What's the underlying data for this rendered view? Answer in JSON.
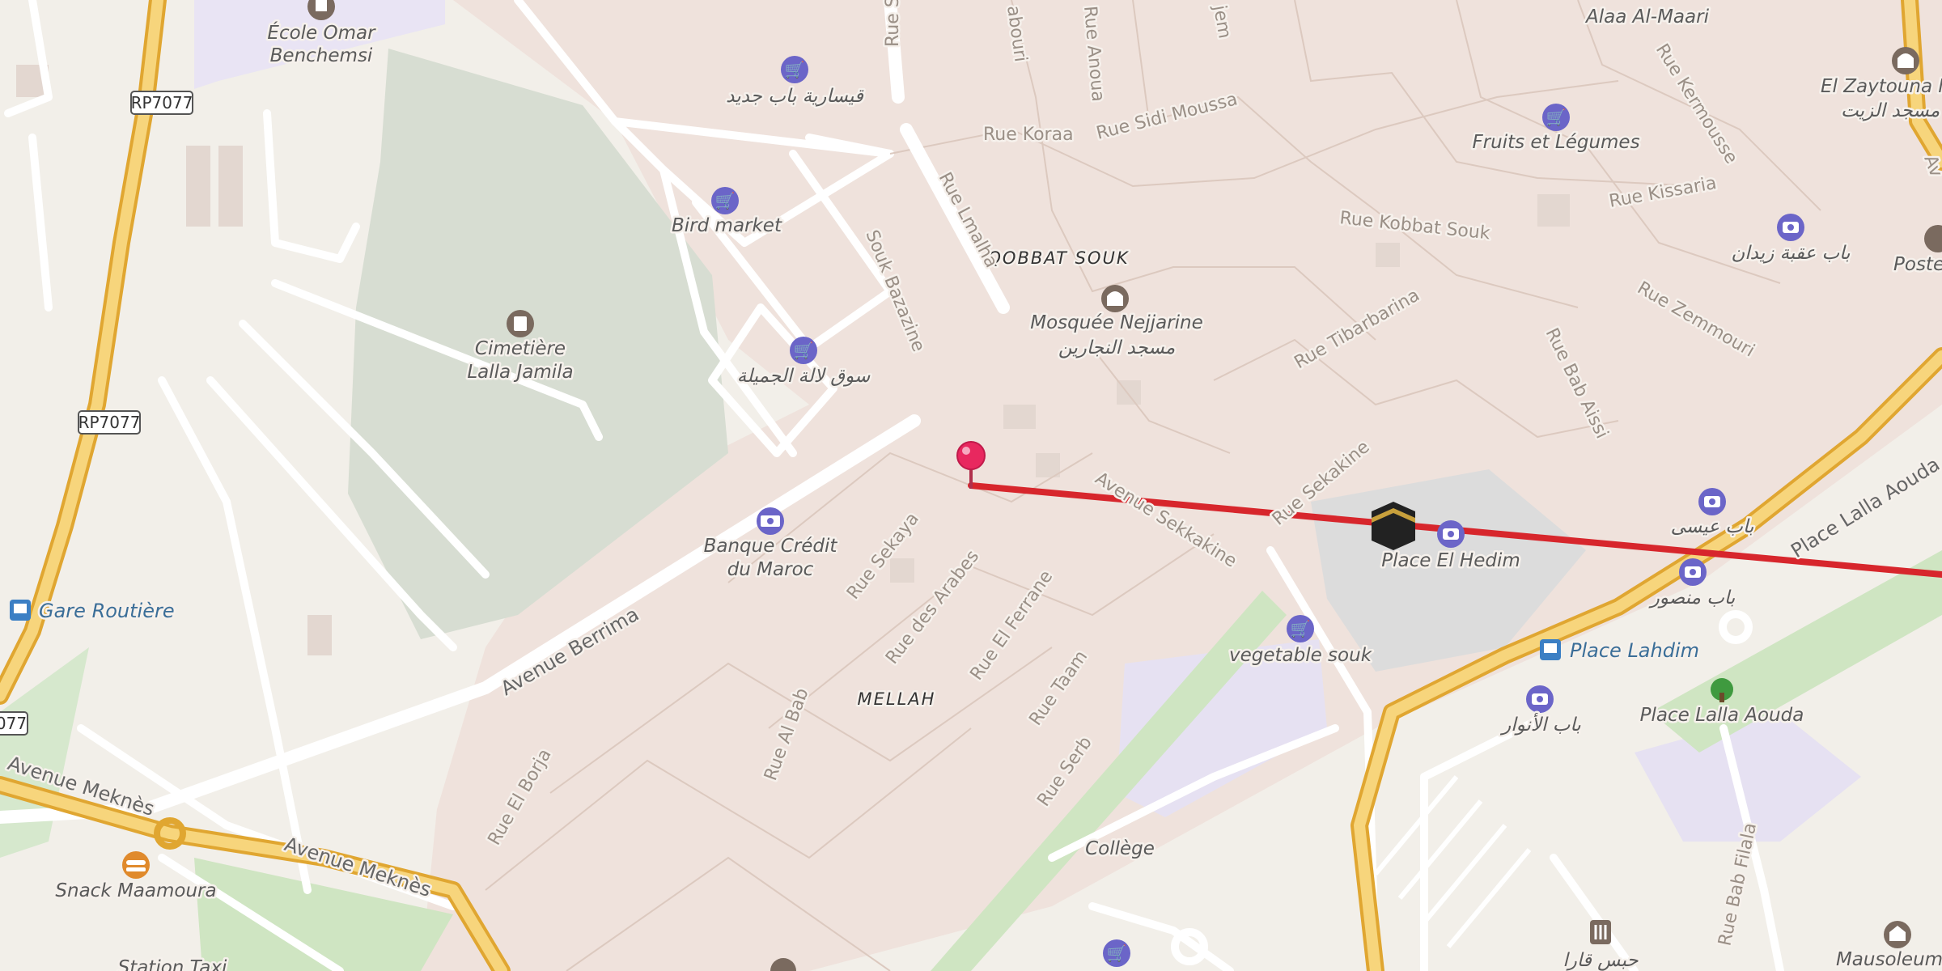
{
  "map": {
    "route_color": "#d7262c",
    "pin_color": "#e8285f",
    "labels": {
      "ecole": "École Omar",
      "ecole2": "Benchemsi",
      "qissaria": "قيسارية باب جديد",
      "bird_market": "Bird market",
      "souk_lalla": "سوق لالة الجميلة",
      "cimetiere": "Cimetière",
      "cimetiere2": "Lalla Jamila",
      "banque": "Banque Crédit",
      "banque2": "du Maroc",
      "mosquee": "Mosquée Nejjarine",
      "mosquee_ar": "مسجد النجارين",
      "qobbat": "QOBBAT SOUK",
      "mellah": "MELLAH",
      "fruits": "Fruits et Légumes",
      "alaa": "Alaa Al-Maari",
      "zaytouna": "El Zaytouna M",
      "zaytouna_ar": "مسجد الزيت",
      "bab_oqba": "باب عقبة زيدان",
      "poste": "Poste I",
      "place_hedim": "Place El Hedim",
      "vegetable_souk": "vegetable souk",
      "bab_issi": "باب عيسى",
      "bab_mansour": "باب منصور",
      "place_lahdim": "Place Lahdim",
      "bab_anouar": "باب الأنوار",
      "place_lalla_aouda": "Place Lalla Aouda",
      "college": "Collège",
      "gare_routiere": "Gare Routière",
      "snack": "Snack Maamoura",
      "station_taxi": "Station Taxi",
      "habs_qara": "حبس قارا",
      "mausoleum": "Mausoleum"
    },
    "streets": {
      "lmalha": "Rue Lmalha",
      "souk_bazazine": "Souk Bazazine",
      "koraa": "Rue Koraa",
      "sidi_moussa": "Rue Sidi Moussa",
      "kobbat_souk": "Rue Kobbat Souk",
      "kissaria": "Rue Kissaria",
      "kermousse": "Rue Kermousse",
      "zemmouri": "Rue Zemmouri",
      "tibarbarina": "Rue Tibarbarina",
      "bab_aissi": "Rue Bab Aissi",
      "sekakine": "Rue Sekakine",
      "av_sekkakine": "Avenue Sekkakine",
      "berrima": "Avenue Berrima",
      "sekaya": "Rue Sekaya",
      "des_arabes": "Rue des Arabes",
      "el_ferrane": "Rue El Ferrane",
      "taam": "Rue Taam",
      "serb": "Rue Serb",
      "al_bab": "Rue Al Bab",
      "el_borja": "Rue El Borja",
      "meknes1": "Avenue Meknès",
      "meknes2": "Avenue Meknès",
      "place_lalla_aouda_st": "Place Lalla Aouda",
      "bab_filala": "Rue Bab Filala",
      "rue_s": "Rue S",
      "jem": "jem",
      "abouri": "abouri",
      "anoua": "Rue Anoua",
      "av": "Av"
    },
    "shields": [
      "RP7077",
      "RP7077",
      "077"
    ]
  }
}
